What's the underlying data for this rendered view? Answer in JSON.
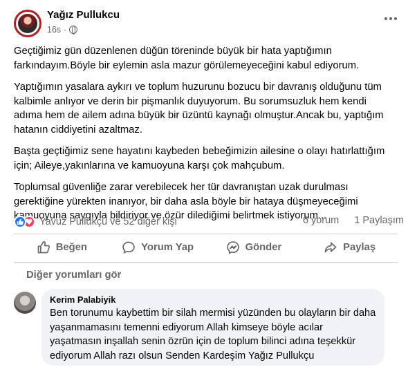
{
  "post": {
    "author": "Yağız Pullukcu",
    "time": "16s",
    "separator": "·",
    "paragraphs": [
      "Geçtiğimiz gün düzenlenen düğün töreninde büyük bir hata yaptığımın farkındayım.Böyle bir eylemin asla mazur görülemeyeceğini kabul ediyorum.",
      "Yaptığımın yasalara aykırı ve toplum huzurunu bozucu bir davranış olduğunu tüm kalbimle anlıyor ve derin bir pişmanlık duyuyorum. Bu sorumsuzluk hem kendi adıma hem de ailem adına büyük bir üzüntü kaynağı olmuştur.Ancak bu, yaptığım hatanın ciddiyetini azaltmaz.",
      "Başta geçtiğimiz sene hayatını kaybeden bebeğimizin ailesine o olayı hatırlattığım için; Aileye,yakınlarına ve kamuoyuna karşı çok mahçubum.",
      "Toplumsal güvenliğe zarar verebilecek her tür davranıştan uzak durulması gerektiğine yürekten inanıyor, bir daha asla böyle bir hataya düşmeyeceğimi kamuoyuna saygıyla bildiriyor ve özür dilediğimi belirtmek istiyorum..."
    ]
  },
  "reactions": {
    "summary": "Yavuz Pullukçu ve 52 diğer kişi",
    "comments_count": "6 yorum",
    "shares_count": "1 Paylaşım",
    "icons": [
      "like-icon",
      "love-icon"
    ]
  },
  "actions": {
    "like": "Beğen",
    "comment": "Yorum Yap",
    "send": "Gönder",
    "share": "Paylaş"
  },
  "comments": {
    "see_more": "Diğer yorumları gör",
    "items": [
      {
        "author": "Kerim Palabiyik",
        "text": "Ben torunumu kaybettim bir silah mermisi yüzünden bu olayların bir daha yaşanmamasını temenni ediyorum Allah kimseye böyle acılar yaşatmasın inşallah senin özrün için de toplum bilinci adına teşekkür ediyorum Allah razı olsun Senden Kardeşim Yağız Pullukçu"
      }
    ]
  },
  "colors": {
    "text": "#050505",
    "muted": "#65676b",
    "like_blue": "#1877f2",
    "love_red": "#f33e58",
    "bubble_bg": "#f0f2f5"
  }
}
